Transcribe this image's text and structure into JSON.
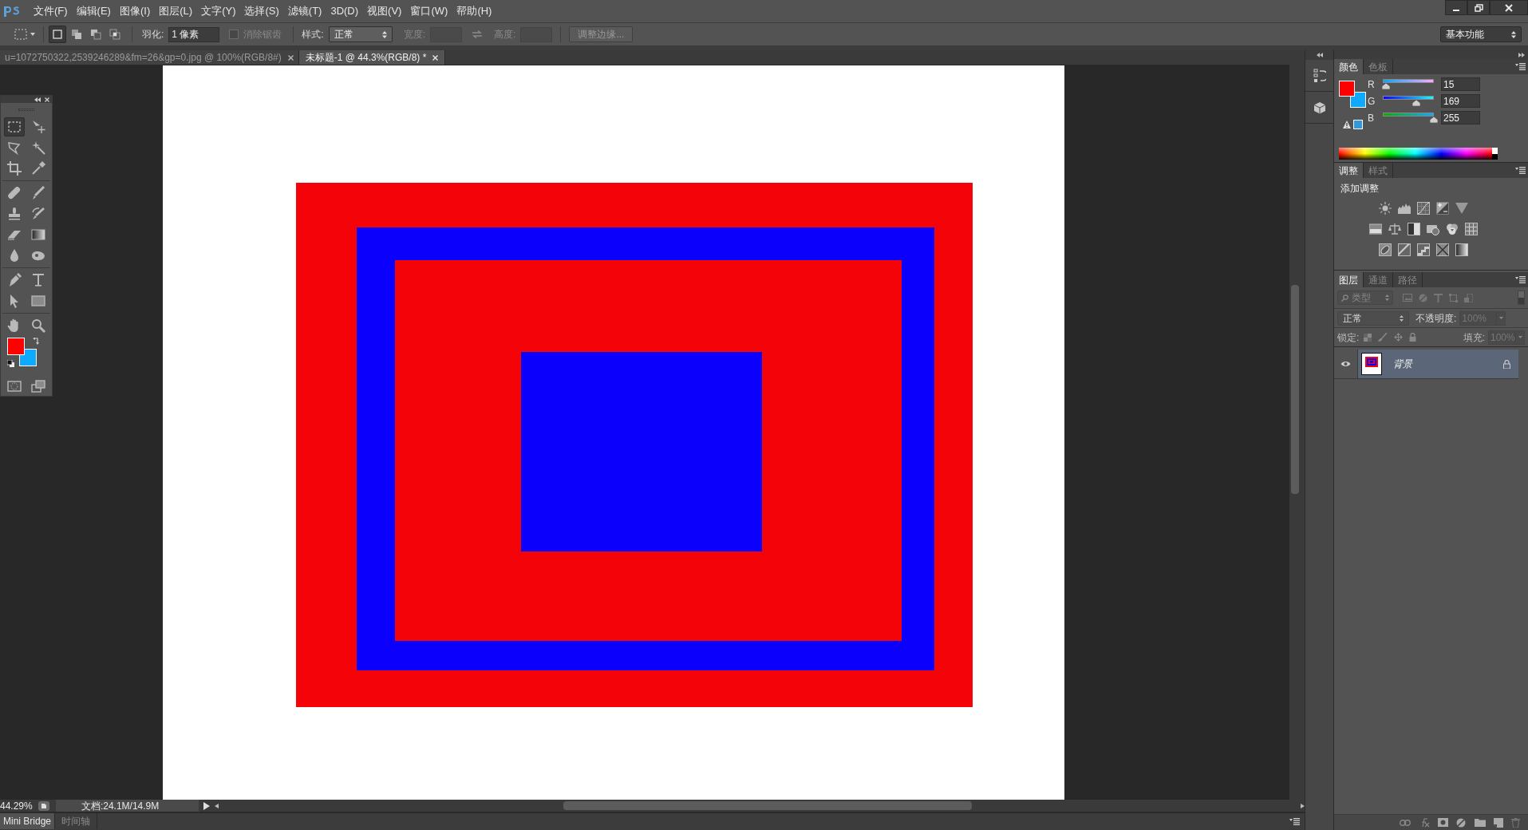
{
  "menu_bar": {
    "items": [
      "文件(F)",
      "编辑(E)",
      "图像(I)",
      "图层(L)",
      "文字(Y)",
      "选择(S)",
      "滤镜(T)",
      "3D(D)",
      "视图(V)",
      "窗口(W)",
      "帮助(H)"
    ]
  },
  "options_bar": {
    "selection_modes": [
      {
        "selected": true
      },
      {
        "selected": false
      },
      {
        "selected": false
      },
      {
        "selected": false
      }
    ],
    "feather_label": "羽化:",
    "feather_value": "1 像素",
    "anti_alias": {
      "label": "消除锯齿",
      "checked": false,
      "disabled": true
    },
    "style_label": "样式:",
    "style_value": "正常",
    "width_label": "宽度:",
    "height_label": "高度:",
    "refine_button": "调整边缘...",
    "workspace": "基本功能"
  },
  "document_tabs": [
    {
      "label": "u=1072750322,2539246289&fm=26&gp=0.jpg @ 100%(RGB/8#)",
      "selected": false
    },
    {
      "label": "未标题-1 @ 44.3%(RGB/8) *",
      "selected": true
    }
  ],
  "tools": [
    {
      "selected": true
    },
    {
      "selected": false
    },
    {
      "selected": false
    },
    {
      "selected": false
    },
    {
      "selected": false
    },
    {
      "selected": false
    },
    {
      "selected": false
    },
    {
      "selected": false
    },
    {
      "selected": false
    },
    {
      "selected": false
    },
    {
      "selected": false
    },
    {
      "selected": false
    },
    {
      "selected": false
    },
    {
      "selected": false
    },
    {
      "selected": false
    },
    {
      "selected": false
    },
    {
      "selected": false
    },
    {
      "selected": false
    },
    {
      "selected": false
    },
    {
      "selected": false
    },
    {
      "selected": false
    },
    {
      "selected": false
    }
  ],
  "swatches": [
    {
      "kind": "foreground",
      "color": "#ff0000"
    },
    {
      "kind": "background",
      "color": "#0fa9ff"
    }
  ],
  "color_panel": {
    "tabs": [
      {
        "label": "颜色",
        "selected": true
      },
      {
        "label": "色板",
        "selected": false
      }
    ],
    "channels": [
      {
        "name": "R",
        "level": 0.059,
        "value": "15"
      },
      {
        "name": "G",
        "level": 0.663,
        "value": "169"
      },
      {
        "name": "B",
        "level": 1,
        "value": "255"
      }
    ]
  },
  "adjustments_panel": {
    "tabs": [
      {
        "label": "调整",
        "selected": true
      },
      {
        "label": "样式",
        "selected": false
      }
    ],
    "heading": "添加调整"
  },
  "layers_panel": {
    "tabs": [
      {
        "label": "图层",
        "selected": true
      },
      {
        "label": "通道",
        "selected": false
      },
      {
        "label": "路径",
        "selected": false
      }
    ],
    "filter": "类型",
    "blend_mode": "正常",
    "opacity_label": "不透明度:",
    "opacity": "100%",
    "lock_label": "锁定:",
    "fill_label": "填充:",
    "fill": "100%",
    "layers": [
      {
        "name": "背景",
        "visible": true,
        "selected": true,
        "locked": true
      }
    ]
  },
  "status_bar": {
    "zoom": "44.29%",
    "doc_info": "文档:24.1M/14.9M"
  },
  "bottom_tabs": [
    {
      "label": "Mini Bridge",
      "selected": true
    },
    {
      "label": "时间轴",
      "selected": false
    }
  ]
}
